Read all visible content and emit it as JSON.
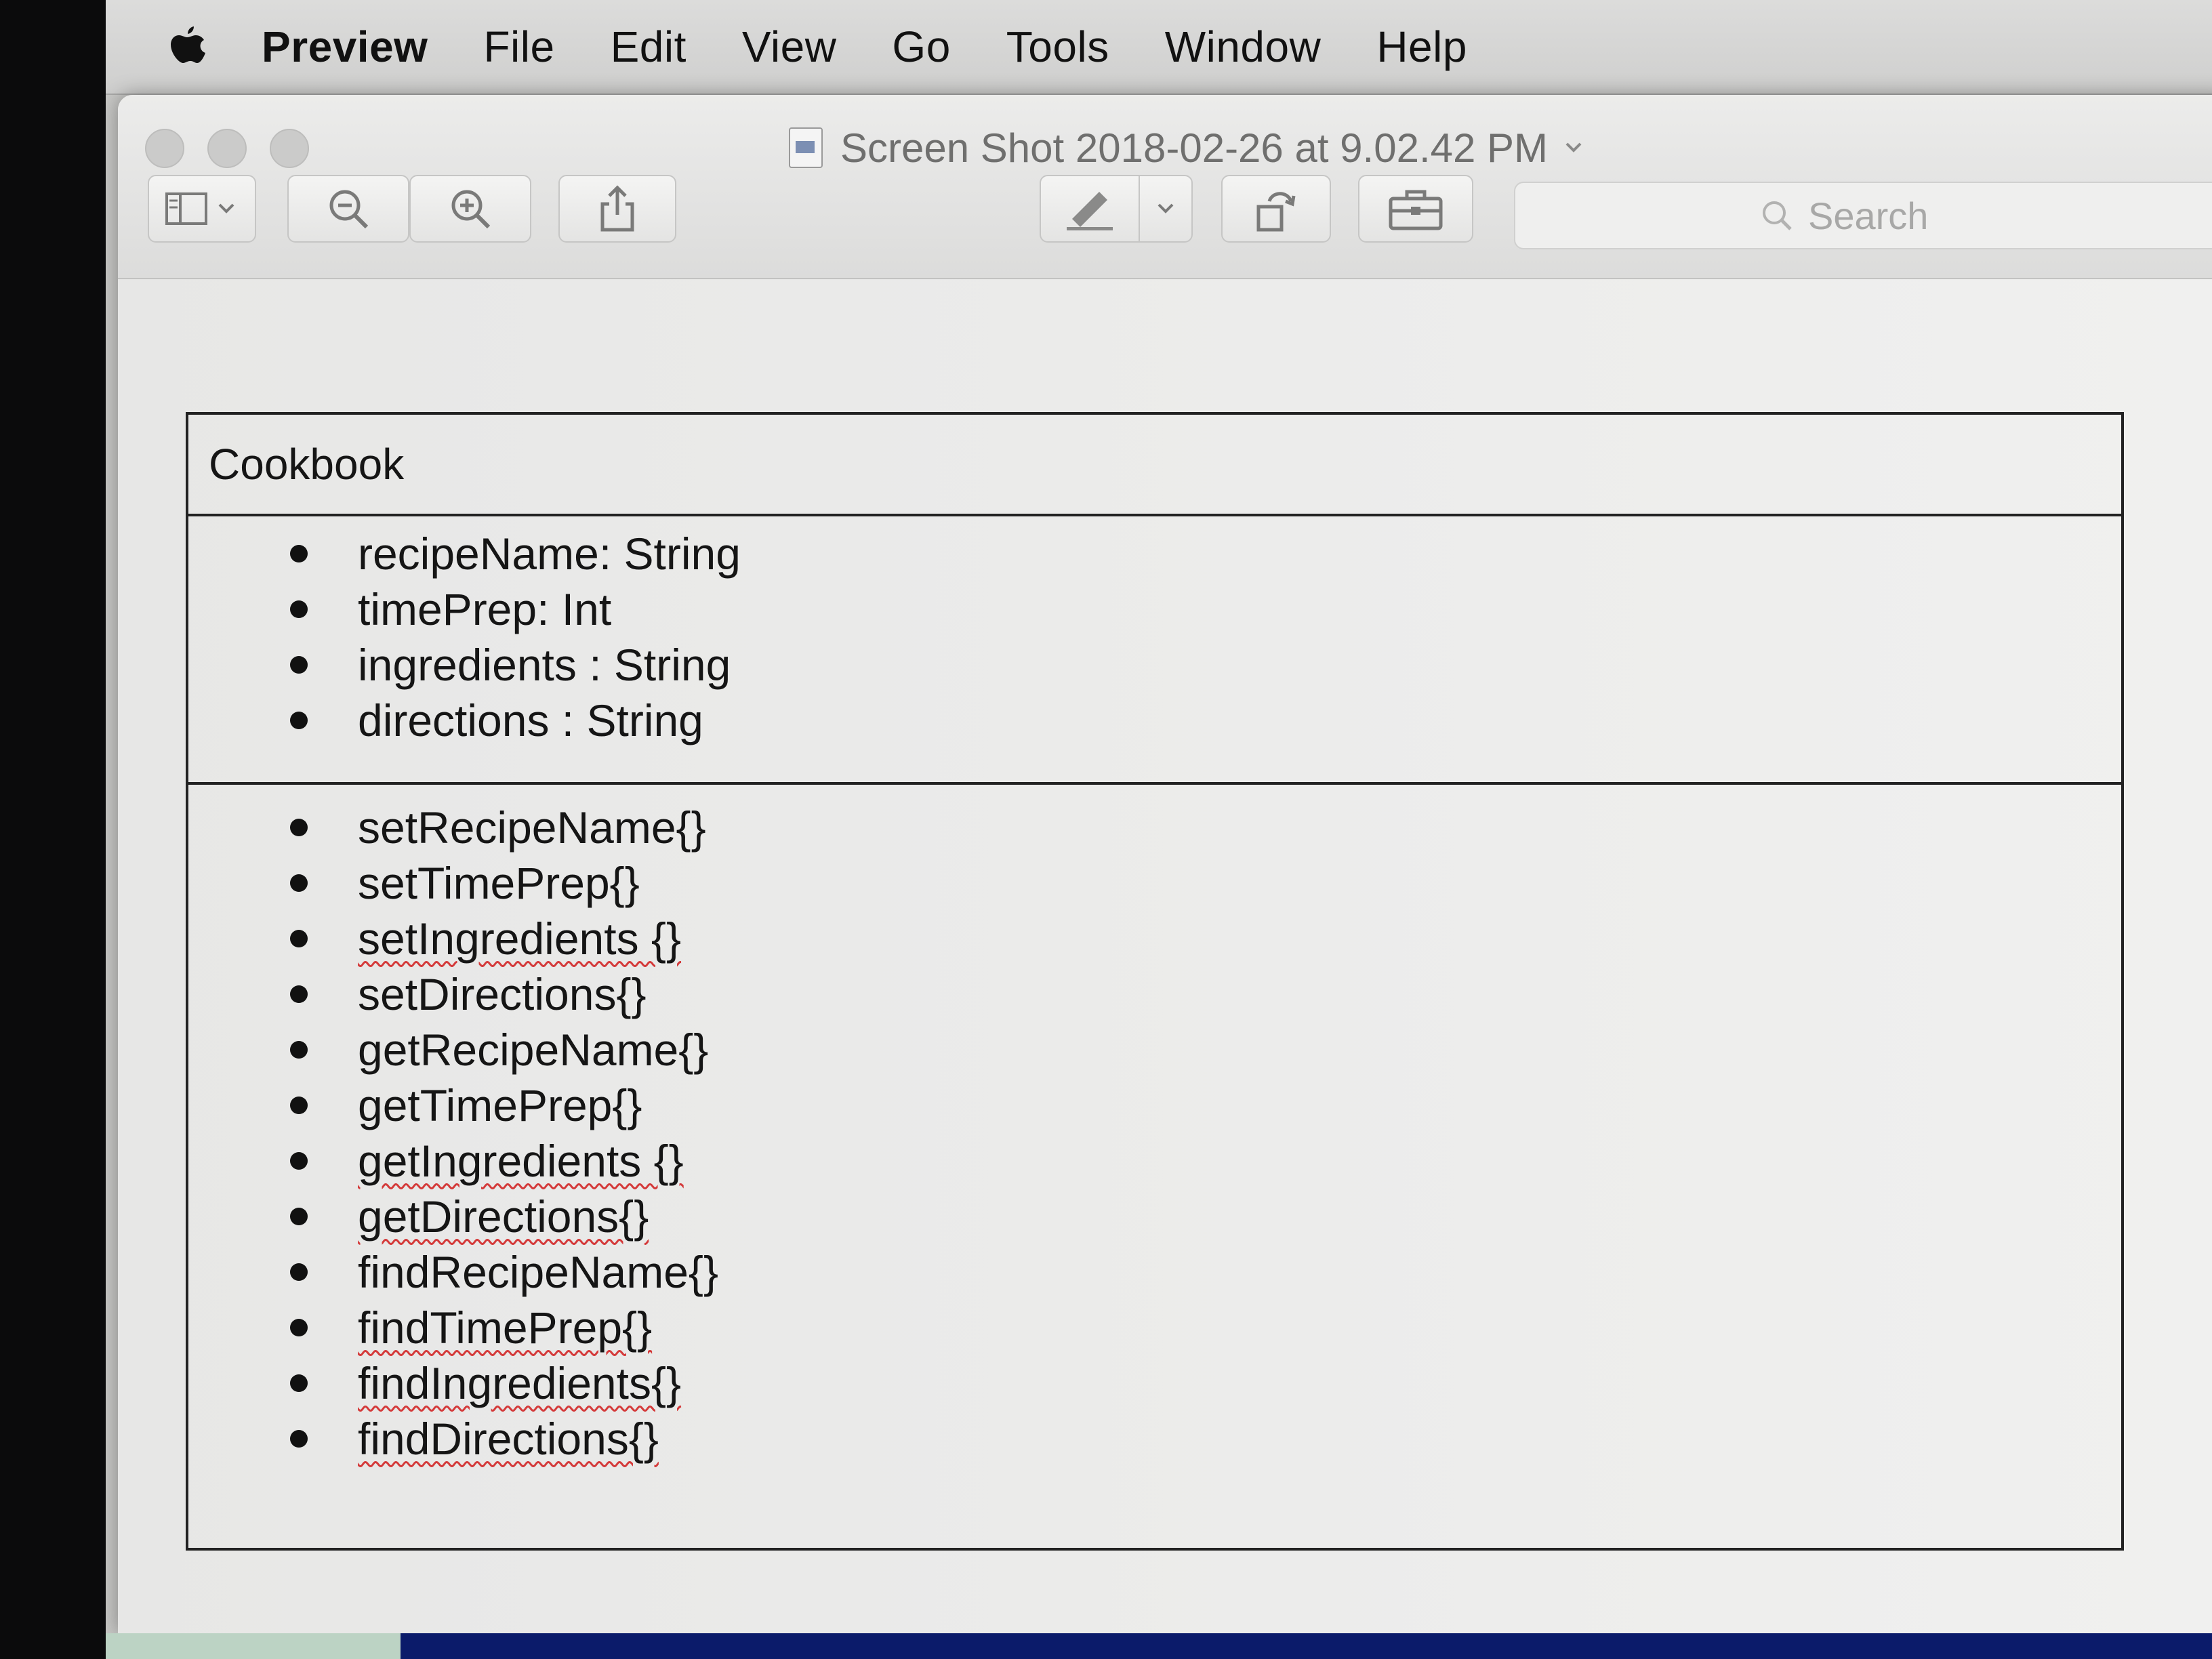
{
  "menubar": {
    "apple_icon": "apple-logo-icon",
    "items": [
      {
        "label": "Preview"
      },
      {
        "label": "File"
      },
      {
        "label": "Edit"
      },
      {
        "label": "View"
      },
      {
        "label": "Go"
      },
      {
        "label": "Tools"
      },
      {
        "label": "Window"
      },
      {
        "label": "Help"
      }
    ]
  },
  "window": {
    "title": "Screen Shot 2018-02-26 at 9.02.42 PM",
    "toolbar": {
      "icons": [
        "sidebar-icon",
        "zoom-out-icon",
        "zoom-in-icon",
        "share-icon",
        "markup-pen-icon",
        "chevron-down-icon",
        "rotate-icon",
        "toolbox-icon"
      ],
      "search": {
        "placeholder": "Search"
      }
    }
  },
  "document": {
    "class_name": "Cookbook",
    "attributes": [
      {
        "text": "recipeName: String"
      },
      {
        "text": "timePrep: Int"
      },
      {
        "text": "ingredients : String"
      },
      {
        "text": "directions : String"
      }
    ],
    "methods": [
      {
        "text": "setRecipeName{}"
      },
      {
        "text": "setTimePrep{}"
      },
      {
        "text": "setIngredients {}"
      },
      {
        "text": "setDirections{}"
      },
      {
        "text": "getRecipeName{}"
      },
      {
        "text": "getTimePrep{}"
      },
      {
        "text": "getIngredients {}"
      },
      {
        "text": "getDirections{}"
      },
      {
        "text": "findRecipeName{}"
      },
      {
        "text": "findTimePrep{}"
      },
      {
        "text": "findIngredients{}"
      },
      {
        "text": "findDirections{}"
      }
    ]
  },
  "colors": {
    "spellcheck_underline": "#d43a3a",
    "menubar_bg": "#d6d6d5",
    "window_bg": "#e6e6e5"
  }
}
